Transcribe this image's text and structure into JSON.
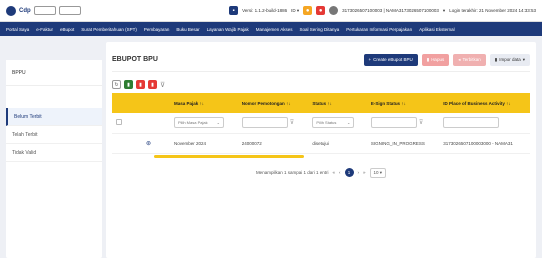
{
  "topbar": {
    "logo_text": "Cdp",
    "logo_box_1": "",
    "logo_box_2": "",
    "version": "Versi: 1.1.2-build-1886",
    "lang": "ID",
    "npwp": "3173026507100003 | NAMA3173026507100003",
    "login_info": "Login terakhir: 21 November 2024 14:33:53"
  },
  "nav": [
    "Portal Saya",
    "e-Faktur",
    "eBupot",
    "Surat Pemberitahuan (SPT)",
    "Pembayaran",
    "Buku Besar",
    "Layanan Wajib Pajak",
    "Manajemen Akses",
    "Soal Sering Ditanya",
    "Pertukaran Informasi Perpajakan",
    "Aplikasi Eksternal"
  ],
  "sidebar": {
    "title": "BPPU",
    "items": [
      "Belum Terbit",
      "Telah Terbit",
      "Tidak Valid"
    ]
  },
  "main": {
    "title": "EBUPOT BPU",
    "create_btn": "Create eBupot BPU",
    "hapus_btn": "Hapus",
    "terbitkan_btn": "Terbitkan",
    "impor_btn": "Impor data"
  },
  "table": {
    "headers": [
      "Masa Pajak",
      "Nomor Pemotongan",
      "Status",
      "E-Sign Status",
      "ID Place of Business Activity"
    ],
    "filters": {
      "masa_pajak": "Pilih Masa Pajak",
      "status": "Pilih Status"
    },
    "rows": [
      {
        "masa": "November 2024",
        "nomor": "24000072",
        "status": "disetujui",
        "esign": "SIGNING_IN_PROGRESS",
        "id": "3173026507100003000 - NAMA31"
      }
    ]
  },
  "pager": {
    "info": "Menampilkan 1 sampai 1 dari 1 entri",
    "current": "1",
    "page_size": "10"
  },
  "colors": {
    "primary": "#1e3a7a",
    "header": "#f5c518",
    "danger": "#e53935"
  }
}
